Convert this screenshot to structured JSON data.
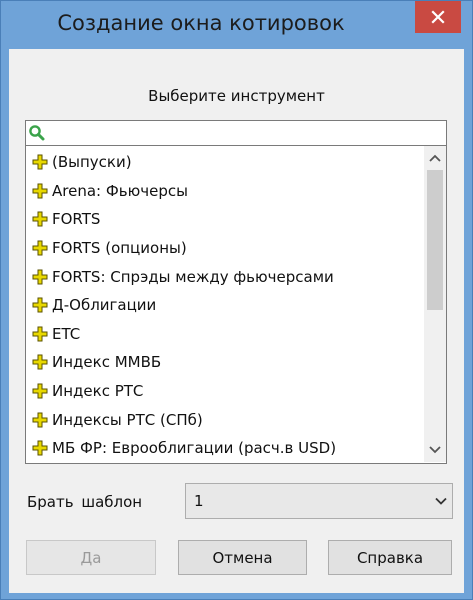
{
  "window": {
    "title": "Создание окна котировок"
  },
  "dialog": {
    "prompt": "Выберите инструмент",
    "search": {
      "value": "",
      "placeholder": ""
    },
    "instruments": [
      "(Выпуски)",
      "Arena: Фьючерсы",
      "FORTS",
      "FORTS (опционы)",
      "FORTS: Спрэды между фьючерсами",
      "Д-Облигации",
      "ETC",
      "Индекс ММВБ",
      "Индекс РТС",
      "Индексы РТС (СПб)",
      "МБ ФР: Еврооблигации (расч.в USD)"
    ],
    "template": {
      "label": "Брать шаблон",
      "selected": "1"
    },
    "buttons": {
      "ok": "Да",
      "cancel": "Отмена",
      "help": "Справка"
    }
  },
  "colors": {
    "titlebar": "#6fa3d8",
    "close": "#c94a42",
    "plus_icon": "#e8d800",
    "search_icon": "#3aa34a"
  },
  "icons": {
    "close": "close-icon",
    "search": "search-icon",
    "expand": "plus-icon",
    "scroll_up": "chevron-up-icon",
    "scroll_down": "chevron-down-icon",
    "dropdown": "chevron-down-icon"
  }
}
